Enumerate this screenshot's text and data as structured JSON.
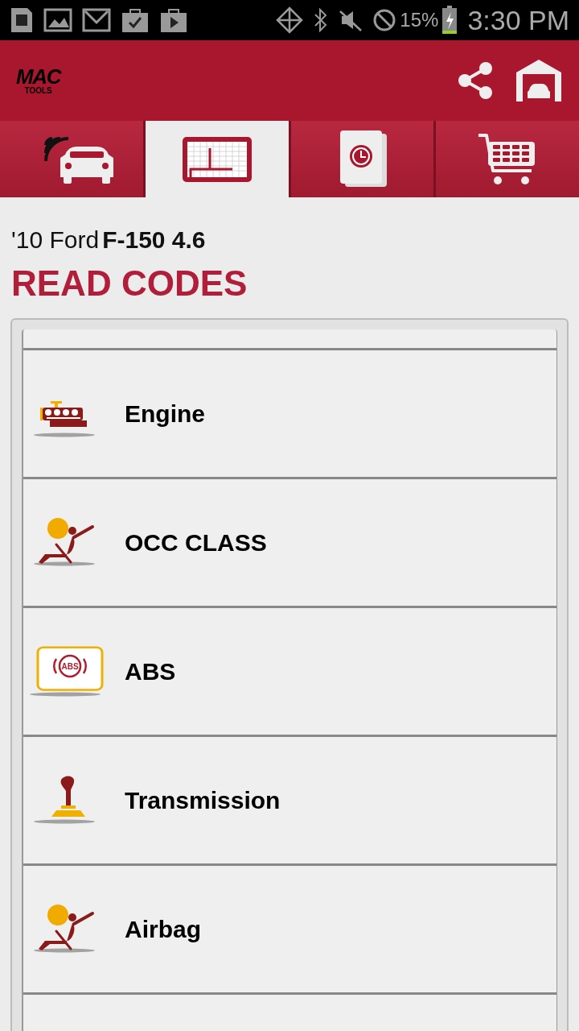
{
  "status_bar": {
    "battery": "15%",
    "time": "3:30 PM"
  },
  "header": {
    "logo_top": "MAC",
    "logo_bottom": "TOOLS"
  },
  "tabs": [
    {
      "kind": "vehicle",
      "selected": false
    },
    {
      "kind": "codes",
      "selected": true
    },
    {
      "kind": "history",
      "selected": false
    },
    {
      "kind": "shop",
      "selected": false
    }
  ],
  "vehicle": {
    "year_make": "'10 Ford",
    "model": "F-150 4.6"
  },
  "title": "READ CODES",
  "systems": [
    {
      "kind": "engine",
      "label": "Engine"
    },
    {
      "kind": "occupant",
      "label": "OCC CLASS"
    },
    {
      "kind": "abs",
      "label": "ABS",
      "icon_text": "ABS"
    },
    {
      "kind": "transmission",
      "label": "Transmission"
    },
    {
      "kind": "occupant",
      "label": "Airbag"
    }
  ]
}
